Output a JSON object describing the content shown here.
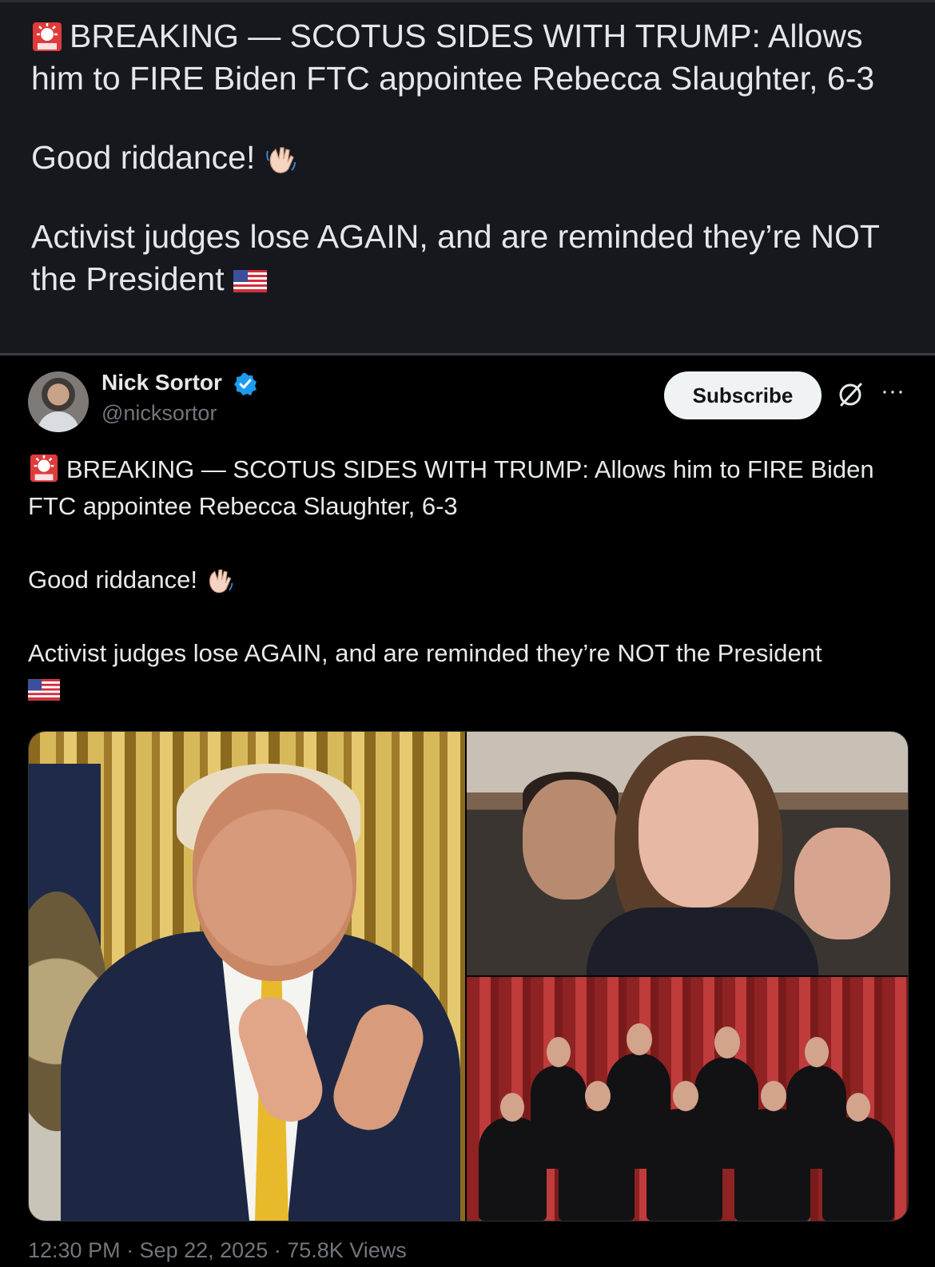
{
  "outer_post": {
    "line1": "BREAKING — SCOTUS SIDES WITH TRUMP: Allows him to FIRE Biden FTC appointee Rebecca Slaughter, 6-3",
    "line2": "Good riddance!",
    "line3": "Activist judges lose AGAIN, and are reminded they’re NOT the President"
  },
  "embedded_tweet": {
    "author_name": "Nick Sortor",
    "author_handle": "@nicksortor",
    "subscribe_label": "Subscribe",
    "text_line1": "BREAKING — SCOTUS SIDES WITH TRUMP: Allows him to FIRE Biden FTC appointee Rebecca Slaughter, 6-3",
    "text_line2": "Good riddance!",
    "text_line3": "Activist judges lose AGAIN, and are reminded they’re NOT the President",
    "meta": "12:30 PM · Sep 22, 2025 · 75.8K Views"
  },
  "icons": {
    "siren": "police-siren-icon",
    "wave": "waving-hand-icon",
    "flag": "us-flag-icon",
    "verified": "verified-badge-icon",
    "grok": "grok-icon",
    "more": "more-options-icon"
  },
  "colors": {
    "outer_bg": "#16181d",
    "embed_bg": "#000000",
    "verified_blue": "#1d9bf0",
    "muted_text": "#71767b"
  }
}
